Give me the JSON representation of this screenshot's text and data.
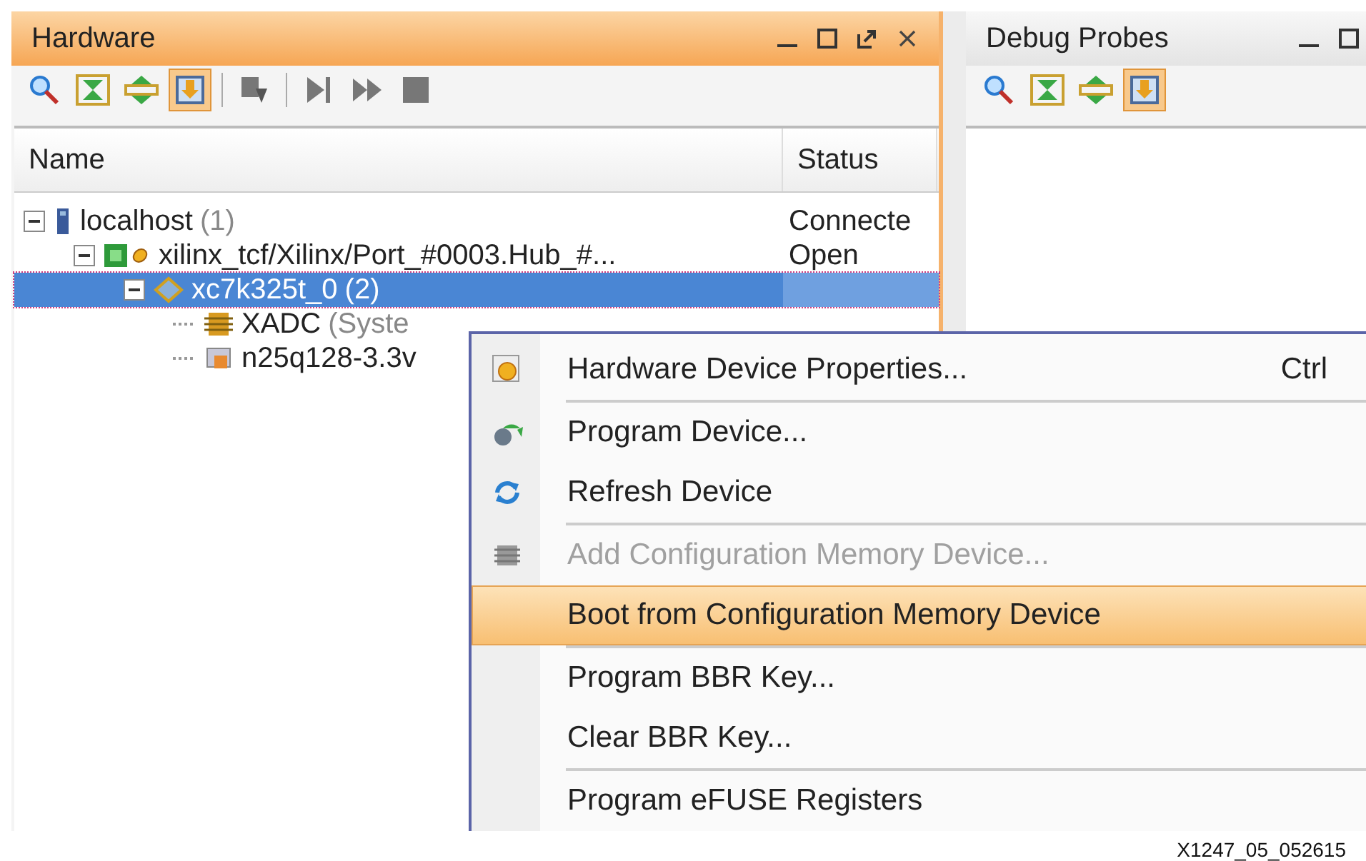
{
  "panels": [
    {
      "title": "Hardware",
      "active": true,
      "controls": [
        {
          "kind": "minimize"
        },
        {
          "kind": "maximize"
        },
        {
          "kind": "float"
        },
        {
          "kind": "close"
        }
      ],
      "toolbar": [
        {
          "buttons": [
            {
              "kind": "search",
              "selected": false,
              "disabled": false
            },
            {
              "kind": "collapse",
              "selected": false,
              "disabled": false
            },
            {
              "kind": "expand",
              "selected": false,
              "disabled": false
            },
            {
              "kind": "autoconnect",
              "selected": true,
              "disabled": false
            }
          ]
        },
        {
          "buttons": [
            {
              "kind": "program",
              "selected": false,
              "disabled": true
            }
          ]
        },
        {
          "buttons": [
            {
              "kind": "step",
              "selected": false,
              "disabled": true
            },
            {
              "kind": "run",
              "selected": false,
              "disabled": true
            },
            {
              "kind": "stop",
              "selected": false,
              "disabled": true
            }
          ]
        }
      ],
      "table": {
        "columns": [
          "Name",
          "Status"
        ],
        "tree": [
          {
            "name": "localhost",
            "count": "(1)",
            "kind": "server",
            "status": "Connecte",
            "expanded": true,
            "selected": false,
            "children": [
              {
                "name": "xilinx_tcf/Xilinx/Port_#0003.Hub_#...",
                "kind": "board",
                "status": "Open",
                "expanded": true,
                "selected": false,
                "children": [
                  {
                    "name": "xc7k325t_0",
                    "count": "(2)",
                    "kind": "chip",
                    "expanded": true,
                    "selected": true,
                    "children": [
                      {
                        "name": "XADC",
                        "count": "(Syste",
                        "kind": "sensor",
                        "selected": false
                      },
                      {
                        "name": "n25q128-3.3v",
                        "kind": "memory",
                        "selected": false
                      }
                    ]
                  }
                ]
              }
            ]
          }
        ]
      }
    },
    {
      "title": "Debug Probes",
      "active": false,
      "controls": [
        {
          "kind": "minimize"
        },
        {
          "kind": "maximize"
        }
      ],
      "toolbar": [
        {
          "buttons": [
            {
              "kind": "search",
              "selected": false,
              "disabled": false
            },
            {
              "kind": "collapse",
              "selected": false,
              "disabled": false
            },
            {
              "kind": "expand",
              "selected": false,
              "disabled": false
            },
            {
              "kind": "autoconnect",
              "selected": true,
              "disabled": false
            }
          ]
        }
      ]
    }
  ],
  "context_menu": {
    "items": [
      {
        "label": "Hardware Device Properties...",
        "shortcut": "Ctrl",
        "kind": "properties",
        "disabled": false,
        "selected": false,
        "separator_after": true
      },
      {
        "label": "Program Device...",
        "kind": "program",
        "disabled": false,
        "selected": false,
        "separator_after": false
      },
      {
        "label": "Refresh Device",
        "kind": "refresh",
        "disabled": false,
        "selected": false,
        "separator_after": true
      },
      {
        "label": "Add Configuration Memory Device...",
        "kind": "memory",
        "disabled": true,
        "selected": false,
        "separator_after": false
      },
      {
        "label": "Boot from Configuration Memory Device",
        "disabled": false,
        "selected": true,
        "separator_after": true
      },
      {
        "label": "Program BBR Key...",
        "disabled": false,
        "selected": false,
        "separator_after": false
      },
      {
        "label": "Clear BBR Key...",
        "disabled": false,
        "selected": false,
        "separator_after": true
      },
      {
        "label": "Program eFUSE Registers",
        "disabled": false,
        "selected": false,
        "separator_after": false
      }
    ]
  },
  "figure_id": "X1247_05_052615"
}
